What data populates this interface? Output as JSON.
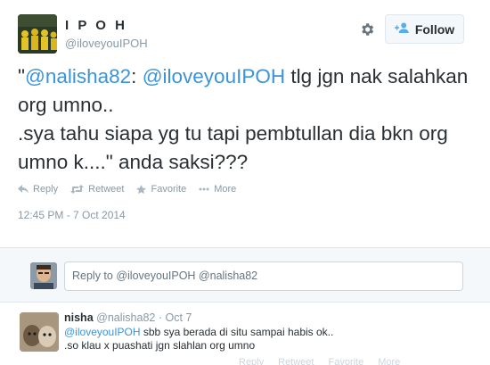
{
  "profile": {
    "full_name": "I P O H",
    "username": "@iloveyouIPOH",
    "follow_label": "Follow"
  },
  "tweet": {
    "open_quote": "\"",
    "mention1": "@nalisha82",
    "sep": ":  ",
    "mention2": "@iloveyouIPOH",
    "text_rest": " tlg jgn nak salahkan org umno..\n.sya tahu siapa yg tu tapi pembtullan dia bkn org umno k....\" anda saksi???"
  },
  "actions": {
    "reply": "Reply",
    "retweet": "Retweet",
    "favorite": "Favorite",
    "more": "More"
  },
  "timestamp": "12:45 PM - 7 Oct 2014",
  "reply_box": {
    "prefix": "Reply to ",
    "mentions": "@iloveyouIPOH @nalisha82"
  },
  "reply_tweet": {
    "name": "nisha",
    "handle": "@nalisha82",
    "dot": " · ",
    "date": "Oct 7",
    "mention": "@iloveyouIPOH",
    "line1_rest": " sbb sya berada di situ sampai habis ok..",
    "line2": ".so klau x puashati jgn slahlan org umno",
    "actions": {
      "reply": "Reply",
      "retweet": "Retweet",
      "favorite": "Favorite",
      "more": "More"
    }
  },
  "colors": {
    "link": "#3b94d9",
    "text": "#292f33",
    "muted": "#8899a6",
    "follow_icon": "#55acee"
  }
}
